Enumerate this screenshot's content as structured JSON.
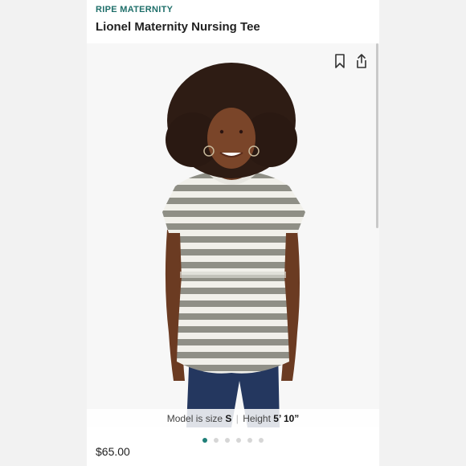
{
  "product": {
    "brand": "RIPE MATERNITY",
    "title": "Lionel Maternity Nursing Tee",
    "price": "$65.00"
  },
  "gallery": {
    "model_info": {
      "prefix": "Model is size",
      "size": "S",
      "separator": "|",
      "height_label": "Height",
      "height": "5’ 10”"
    },
    "slide_count": 6,
    "active_slide": 1
  },
  "icons": {
    "bookmark": "bookmark-icon",
    "share": "share-icon"
  },
  "colors": {
    "brand_teal": "#1f6f6a",
    "active_dot": "#1f7f78",
    "stripe_gray": "#8f8f86"
  }
}
